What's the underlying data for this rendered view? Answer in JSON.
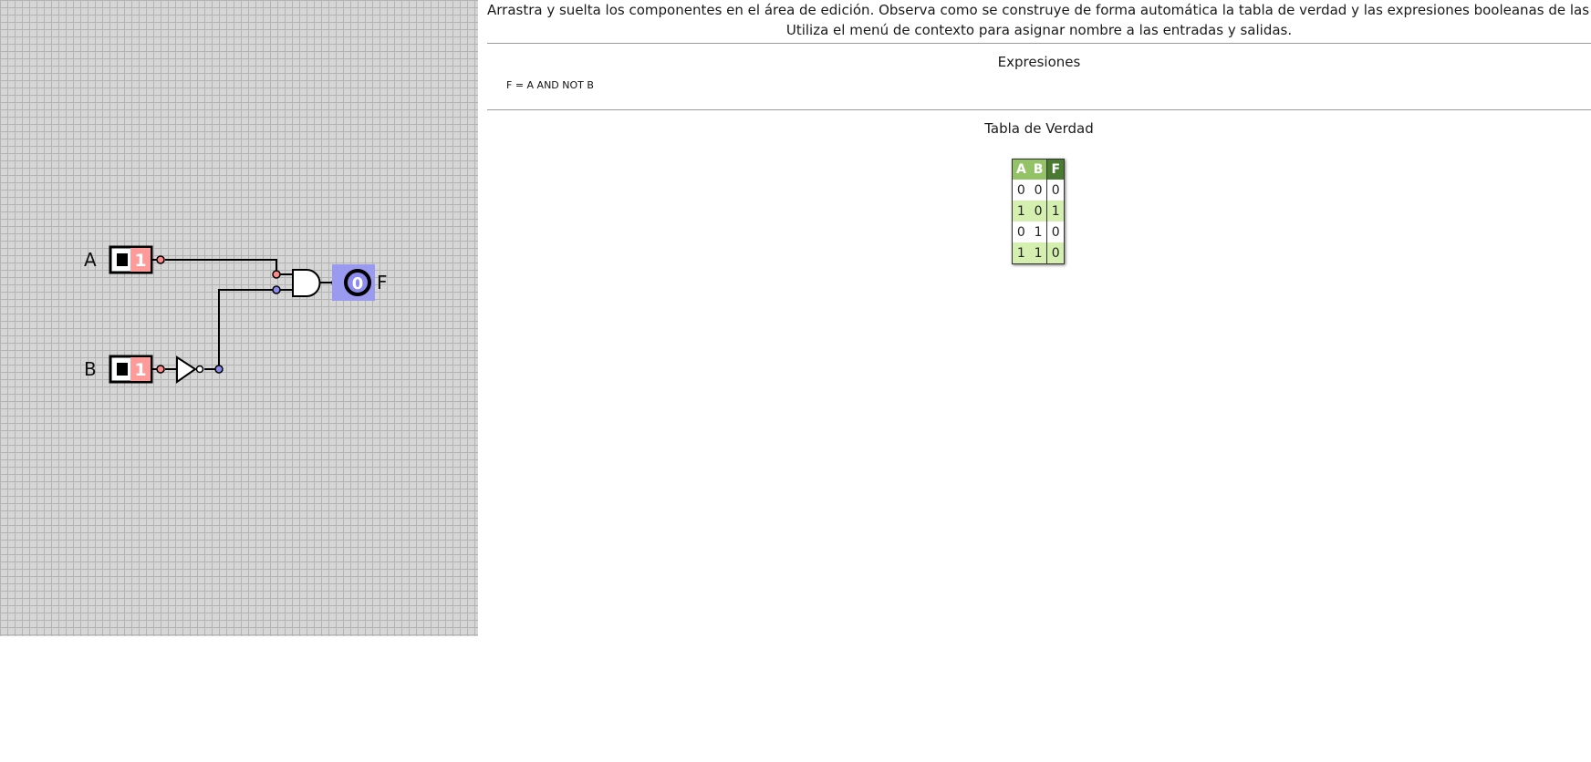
{
  "editor": {
    "inputs": [
      {
        "label": "A",
        "value": "1"
      },
      {
        "label": "B",
        "value": "1"
      }
    ],
    "output": {
      "label": "F",
      "value": "0"
    }
  },
  "instructions": {
    "line1": "Arrastra y suelta los componentes en el área de edición. Observa como se construye de forma automática la tabla de verdad y las expresiones booleanas de las salidas.",
    "line2": "Utiliza el menú de contexto para asignar nombre a las entradas y salidas."
  },
  "expressions": {
    "title": "Expresiones",
    "items": [
      "F = A AND NOT B"
    ]
  },
  "truth_table": {
    "title": "Tabla de Verdad",
    "headers": [
      "A",
      "B",
      "F"
    ],
    "rows": [
      [
        "0",
        "0",
        "0"
      ],
      [
        "1",
        "0",
        "1"
      ],
      [
        "0",
        "1",
        "0"
      ],
      [
        "1",
        "1",
        "0"
      ]
    ]
  },
  "colors": {
    "input_on": "#ff9a9a",
    "pin_red": "#ff8a8a",
    "pin_blue": "#8c8cf0",
    "output_highlight": "#9a9af0",
    "table_header": "#94c266",
    "table_header_output": "#4a7a32",
    "table_row_alt": "#d5efb0"
  }
}
